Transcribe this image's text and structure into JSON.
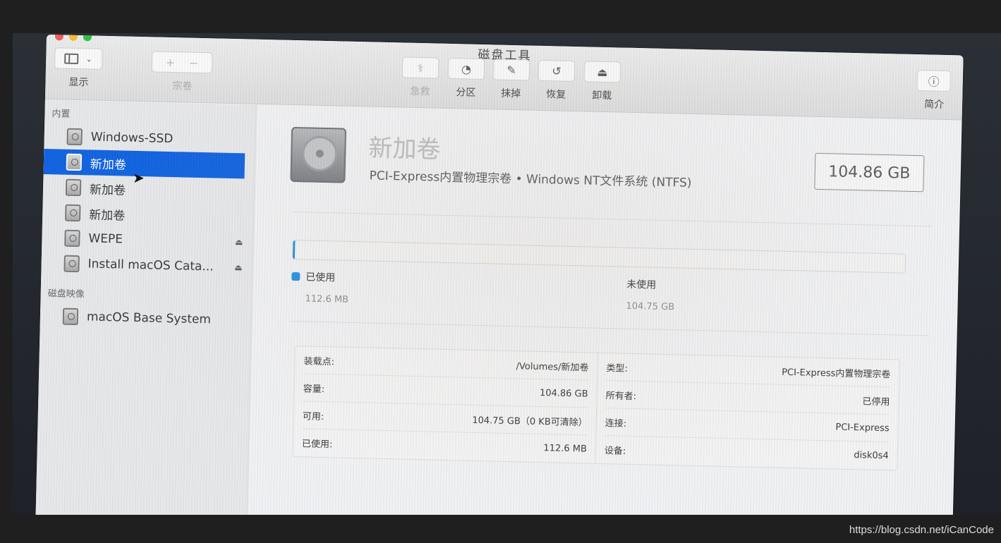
{
  "window": {
    "title": "磁盘工具"
  },
  "toolbar": {
    "display_label": "显示",
    "volume_label": "宗卷",
    "volume_add": "+",
    "volume_remove": "−",
    "items": [
      {
        "label": "急救",
        "icon": "stethoscope-icon"
      },
      {
        "label": "分区",
        "icon": "pie-icon"
      },
      {
        "label": "抹掉",
        "icon": "erase-icon"
      },
      {
        "label": "恢复",
        "icon": "restore-icon"
      },
      {
        "label": "卸载",
        "icon": "unmount-icon"
      }
    ],
    "info_label": "简介"
  },
  "sidebar": {
    "internal_header": "内置",
    "items": [
      {
        "label": "Windows-SSD"
      },
      {
        "label": "新加卷"
      },
      {
        "label": "新加卷"
      },
      {
        "label": "新加卷"
      },
      {
        "label": "WEPE"
      },
      {
        "label": "Install macOS Cata..."
      }
    ],
    "images_header": "磁盘映像",
    "image_items": [
      {
        "label": "macOS Base System"
      }
    ]
  },
  "volume": {
    "name": "新加卷",
    "subtitle": "PCI-Express内置物理宗卷 • Windows NT文件系统 (NTFS)",
    "size": "104.86 GB",
    "used_fraction": 0.001
  },
  "usage": {
    "used_label": "已使用",
    "used_value": "112.6 MB",
    "free_label": "未使用",
    "free_value": "104.75 GB",
    "used_color": "#1e8fe0"
  },
  "info": {
    "left": [
      {
        "k": "装载点:",
        "v": "/Volumes/新加卷"
      },
      {
        "k": "容量:",
        "v": "104.86 GB"
      },
      {
        "k": "可用:",
        "v": "104.75 GB（0 KB可清除）"
      },
      {
        "k": "已使用:",
        "v": "112.6 MB"
      }
    ],
    "right": [
      {
        "k": "类型:",
        "v": "PCI-Express内置物理宗卷"
      },
      {
        "k": "所有者:",
        "v": "已停用"
      },
      {
        "k": "连接:",
        "v": "PCI-Express"
      },
      {
        "k": "设备:",
        "v": "disk0s4"
      }
    ]
  },
  "watermark": "https://blog.csdn.net/iCanCode"
}
